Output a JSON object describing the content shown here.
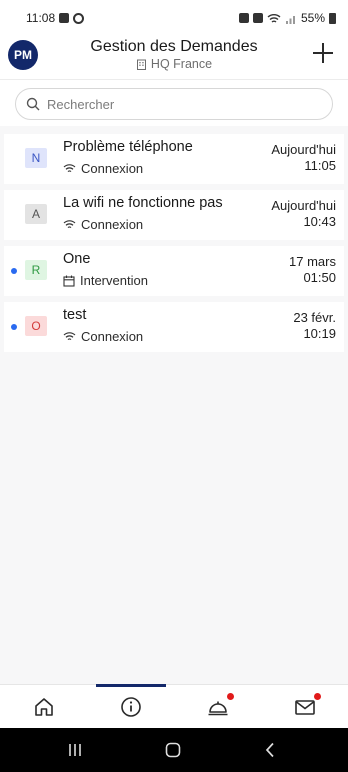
{
  "status_bar": {
    "time": "11:08",
    "battery": "55%"
  },
  "header": {
    "avatar_initials": "PM",
    "title": "Gestion des Demandes",
    "subtitle": "HQ France"
  },
  "search": {
    "placeholder": "Rechercher"
  },
  "requests": [
    {
      "badge": "N",
      "title": "Problème téléphone",
      "category": "Connexion",
      "date_line1": "Aujourd'hui",
      "date_line2": "11:05",
      "unread": false
    },
    {
      "badge": "A",
      "title": "La wifi ne fonctionne pas",
      "category": "Connexion",
      "date_line1": "Aujourd'hui",
      "date_line2": "10:43",
      "unread": false
    },
    {
      "badge": "R",
      "title": "One",
      "category": "Intervention",
      "date_line1": "17 mars",
      "date_line2": "01:50",
      "unread": true
    },
    {
      "badge": "O",
      "title": "test",
      "category": "Connexion",
      "date_line1": "23 févr.",
      "date_line2": "10:19",
      "unread": true
    }
  ],
  "colors": {
    "avatar_bg": "#13286a",
    "unread_dot": "#2a6af0",
    "badge_N_bg": "#dfe4fb",
    "badge_N_fg": "#3b56c4",
    "badge_A_bg": "#e3e3e3",
    "badge_A_fg": "#555555",
    "badge_R_bg": "#dff5e2",
    "badge_R_fg": "#2f9a43",
    "badge_O_bg": "#fbdada",
    "badge_O_fg": "#d33b3b",
    "notification_dot": "#e11a1a"
  },
  "bottom_nav": {
    "items": [
      "home-icon",
      "info-icon",
      "service-bell-icon",
      "mail-icon"
    ],
    "active": "info-icon"
  }
}
